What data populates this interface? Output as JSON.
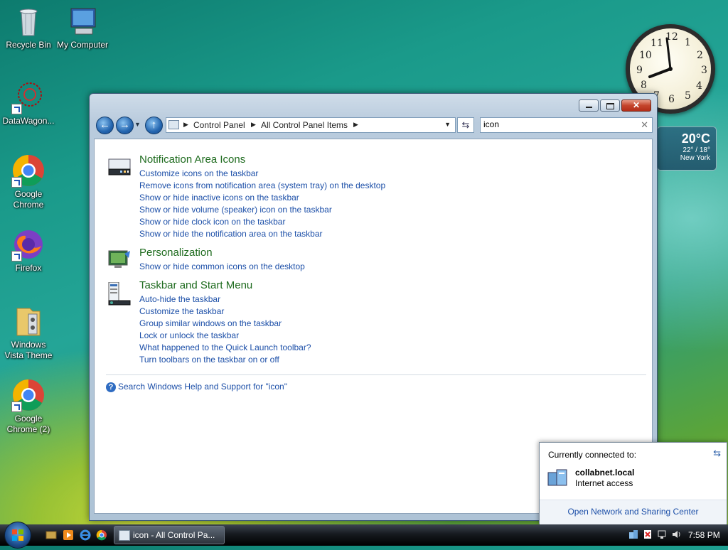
{
  "desktop": {
    "icons": [
      {
        "label": "Recycle Bin"
      },
      {
        "label": "My Computer"
      },
      {
        "label": "DataWagon..."
      },
      {
        "label": "Google Chrome"
      },
      {
        "label": "Firefox"
      },
      {
        "label": "Windows Vista Theme"
      },
      {
        "label": "Google Chrome (2)"
      }
    ]
  },
  "clock": {
    "numbers": [
      "12",
      "1",
      "2",
      "3",
      "4",
      "5",
      "6",
      "7",
      "8",
      "9",
      "10",
      "11"
    ],
    "time_shown": "7:58"
  },
  "weather": {
    "temp": "20°C",
    "range": "22° / 18°",
    "city": "New York"
  },
  "window": {
    "address": {
      "crumbs": [
        "Control Panel",
        "All Control Panel Items"
      ]
    },
    "search": {
      "value": "icon"
    },
    "sections": [
      {
        "title": "Notification Area Icons",
        "links": [
          "Customize icons on the taskbar",
          "Remove icons from notification area (system tray) on the desktop",
          "Show or hide inactive icons on the taskbar",
          "Show or hide volume (speaker) icon on the taskbar",
          "Show or hide clock icon on the taskbar",
          "Show or hide the notification area on the taskbar"
        ]
      },
      {
        "title": "Personalization",
        "links": [
          "Show or hide common icons on the desktop"
        ]
      },
      {
        "title": "Taskbar and Start Menu",
        "links": [
          "Auto-hide the taskbar",
          "Customize the taskbar",
          "Group similar windows on the taskbar",
          "Lock or unlock the taskbar",
          "What happened to the Quick Launch toolbar?",
          "Turn toolbars on the taskbar on or off"
        ]
      }
    ],
    "help_link": "Search Windows Help and Support for \"icon\""
  },
  "network_popup": {
    "header": "Currently connected to:",
    "network_name": "collabnet.local",
    "status": "Internet access",
    "footer_link": "Open Network and Sharing Center"
  },
  "taskbar": {
    "task_button": "icon - All Control Pa...",
    "time": "7:58 PM"
  },
  "colors": {
    "link": "#1c4fa8",
    "section_title": "#1e6b1e"
  }
}
